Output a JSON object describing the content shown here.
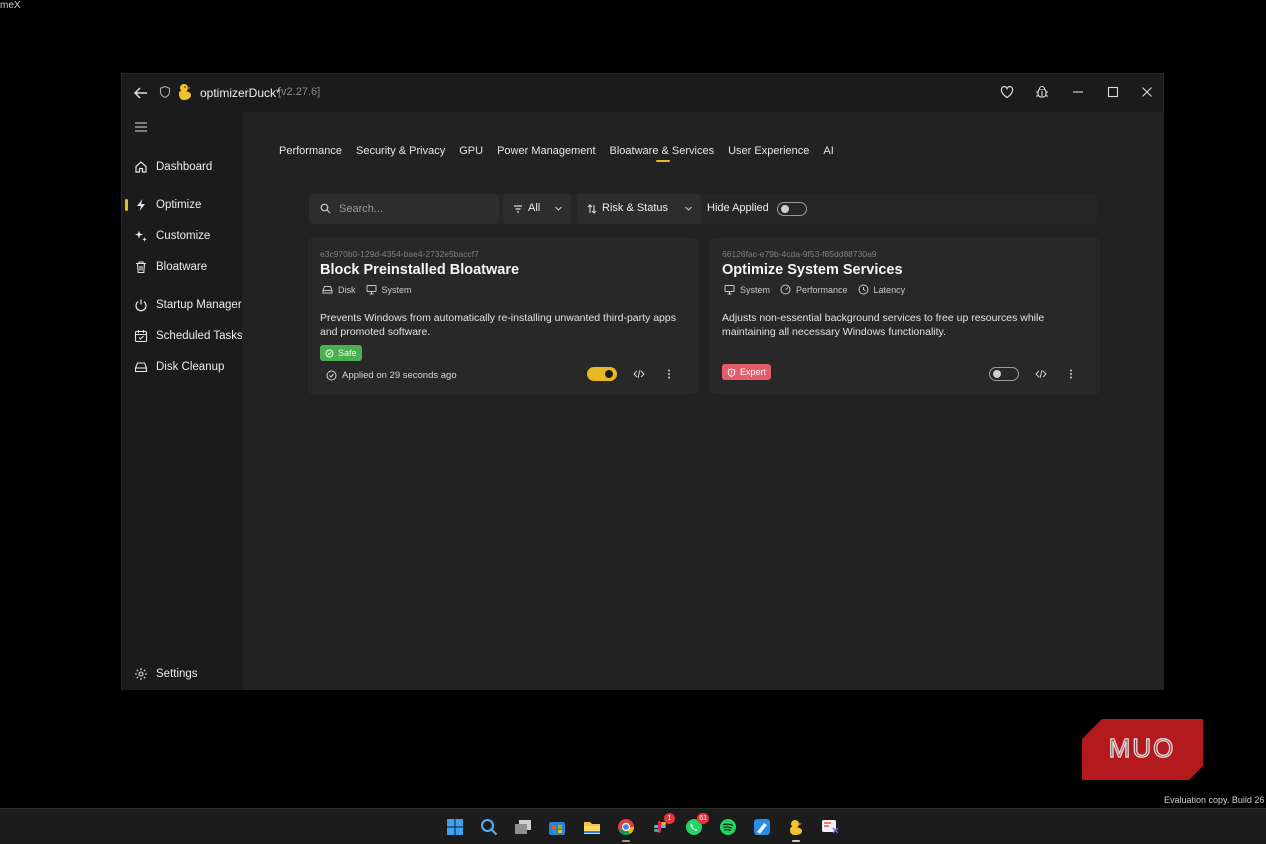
{
  "corner_text": "meX",
  "window": {
    "title": "optimizerDuck*",
    "version": "[v2.27.6]"
  },
  "sidebar": {
    "items": [
      {
        "label": "Dashboard",
        "icon": "home-icon"
      },
      {
        "label": "Optimize",
        "icon": "bolt-icon",
        "active": true
      },
      {
        "label": "Customize",
        "icon": "sparkle-icon"
      },
      {
        "label": "Bloatware",
        "icon": "trash-icon"
      },
      {
        "label": "Startup Manager",
        "icon": "power-icon"
      },
      {
        "label": "Scheduled Tasks",
        "icon": "calendar-icon"
      },
      {
        "label": "Disk Cleanup",
        "icon": "drive-icon"
      }
    ],
    "settings_label": "Settings"
  },
  "tabs": [
    {
      "label": "Performance"
    },
    {
      "label": "Security & Privacy"
    },
    {
      "label": "GPU"
    },
    {
      "label": "Power Management"
    },
    {
      "label": "Bloatware & Services",
      "active": true
    },
    {
      "label": "User Experience"
    },
    {
      "label": "AI"
    }
  ],
  "toolbar": {
    "search_placeholder": "Search...",
    "filter_label": "All",
    "sort_label": "Risk  &  Status",
    "hide_applied_label": "Hide Applied",
    "hide_applied_on": false
  },
  "cards": [
    {
      "id": "e3c970b0-129d-4354-bae4-2732e5baccf7",
      "title": "Block Preinstalled Bloatware",
      "tags": [
        "Disk",
        "System"
      ],
      "description": "Prevents Windows from automatically re-installing unwanted third-party apps and promoted software.",
      "risk": "Safe",
      "status": "Applied on 29 seconds ago",
      "enabled": true
    },
    {
      "id": "66126fac-e79b-4cda-9f53-f85dd88730a9",
      "title": "Optimize System Services",
      "tags": [
        "System",
        "Performance",
        "Latency"
      ],
      "description": "Adjusts non-essential background services to free up resources while maintaining all necessary Windows functionality.",
      "risk": "Expert",
      "enabled": false
    }
  ],
  "taskbar": {
    "apps": [
      "windows-start",
      "search",
      "task-view",
      "store",
      "file-explorer",
      "chrome",
      "slack",
      "whatsapp",
      "spotify",
      "paint",
      "optimizerduck",
      "snipping-tool"
    ],
    "slack_badge": "1",
    "whatsapp_badge": "61"
  },
  "watermark": {
    "text": "MUO",
    "evaluation_text": "Evaluation copy. Build 26"
  },
  "colors": {
    "accent": "#e8b923",
    "safe": "#4caf50",
    "expert": "#e35d6a",
    "window_bg": "#1b1b1b"
  }
}
